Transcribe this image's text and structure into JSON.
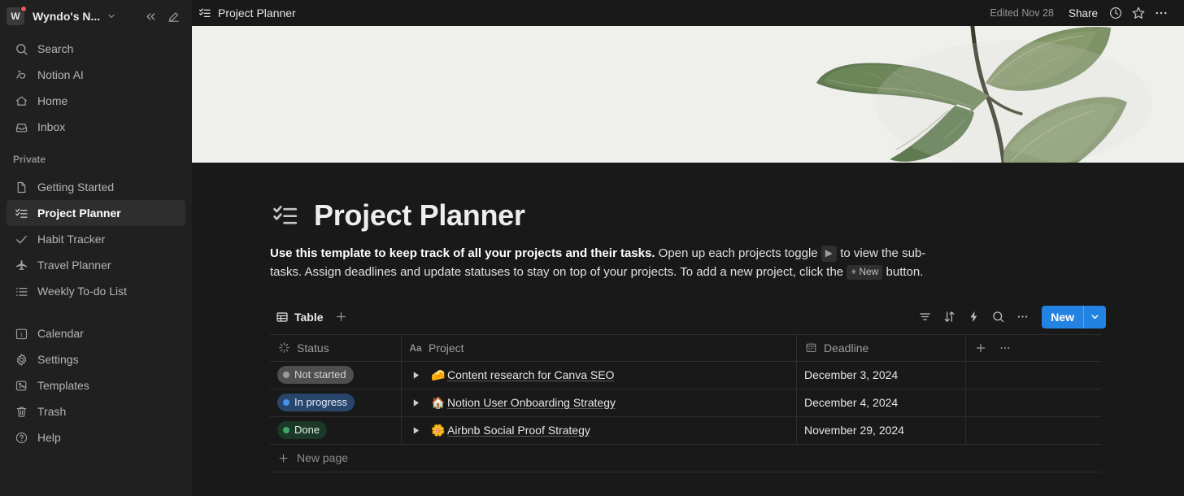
{
  "workspace": {
    "avatar_initial": "W",
    "name": "Wyndo's N...",
    "has_notification": true,
    "collapse_icon": "double-chevron-left-icon",
    "compose_icon": "new-page-edit-icon"
  },
  "sidebar": {
    "top_items": [
      {
        "label": "Search",
        "icon": "search-icon"
      },
      {
        "label": "Notion AI",
        "icon": "notion-ai-icon"
      },
      {
        "label": "Home",
        "icon": "home-icon"
      },
      {
        "label": "Inbox",
        "icon": "inbox-icon"
      }
    ],
    "private_section_label": "Private",
    "private_items": [
      {
        "label": "Getting Started",
        "icon": "document-icon",
        "active": false
      },
      {
        "label": "Project Planner",
        "icon": "checklist-icon",
        "active": true
      },
      {
        "label": "Habit Tracker",
        "icon": "check-icon",
        "active": false
      },
      {
        "label": "Travel Planner",
        "icon": "airplane-icon",
        "active": false
      },
      {
        "label": "Weekly To-do List",
        "icon": "list-icon",
        "active": false
      }
    ],
    "bottom_items": [
      {
        "label": "Calendar",
        "icon": "calendar-icon"
      },
      {
        "label": "Settings",
        "icon": "gear-icon"
      },
      {
        "label": "Templates",
        "icon": "templates-icon"
      },
      {
        "label": "Trash",
        "icon": "trash-icon"
      },
      {
        "label": "Help",
        "icon": "help-circle-icon"
      }
    ]
  },
  "topbar": {
    "breadcrumb": "Project Planner",
    "breadcrumb_icon": "checklist-icon",
    "edited": "Edited Nov 28",
    "share_label": "Share",
    "history_icon": "clock-icon",
    "favorite_icon": "star-icon",
    "more_icon": "ellipsis-icon"
  },
  "page": {
    "icon": "checklist-icon",
    "title": "Project Planner",
    "description": {
      "bold_lead": "Use this template to keep track of all your projects and their tasks.",
      "part1": " Open up each projects toggle ",
      "toggle_chip": "▶",
      "part2": " to view the sub-tasks. Assign deadlines and update statuses to stay on top of your projects. To add a new project, click the ",
      "new_chip_plus": "+",
      "new_chip_label": "New",
      "part3": " button."
    }
  },
  "database": {
    "view_tab": {
      "label": "Table",
      "icon": "table-icon"
    },
    "add_view_icon": "plus-icon",
    "toolbar_icons": [
      {
        "name": "filter-icon"
      },
      {
        "name": "sort-icon"
      },
      {
        "name": "automation-lightning-icon"
      },
      {
        "name": "search-icon"
      },
      {
        "name": "ellipsis-icon"
      }
    ],
    "new_button": {
      "label": "New",
      "dropdown_icon": "chevron-down-icon",
      "color": "#2383e2"
    },
    "columns": [
      {
        "label": "Status",
        "icon": "status-spinner-icon"
      },
      {
        "label": "Project",
        "icon": "title-aa-icon"
      },
      {
        "label": "Deadline",
        "icon": "calendar-icon"
      }
    ],
    "header_actions": [
      {
        "name": "add-column-icon",
        "glyph": "+"
      },
      {
        "name": "column-options-icon",
        "glyph": "⋯"
      }
    ],
    "rows": [
      {
        "status": {
          "label": "Not started",
          "color": "#4f4f4f",
          "pip": "#9b9b9b",
          "text": "#d4d4d3"
        },
        "toggle_icon": "toggle-right-arrow-icon",
        "emoji": "🧀",
        "title": "Content research for Canva SEO",
        "deadline": "December 3, 2024"
      },
      {
        "status": {
          "label": "In progress",
          "color": "#28456c",
          "pip": "#4892e8",
          "text": "#e3eefc"
        },
        "toggle_icon": "toggle-right-arrow-icon",
        "emoji": "🏠",
        "title": "Notion User Onboarding Strategy",
        "deadline": "December 4, 2024"
      },
      {
        "status": {
          "label": "Done",
          "color": "#1c3829",
          "pip": "#3fa568",
          "text": "#dff3e6"
        },
        "toggle_icon": "toggle-right-arrow-icon",
        "emoji": "🌼",
        "title": "Airbnb Social Proof Strategy",
        "deadline": "November 29, 2024"
      }
    ],
    "new_page_row": {
      "label": "New page",
      "icon": "plus-icon"
    }
  },
  "cover": {
    "background_color": "#f2f2f0",
    "subject": "green-leaves-photo"
  }
}
